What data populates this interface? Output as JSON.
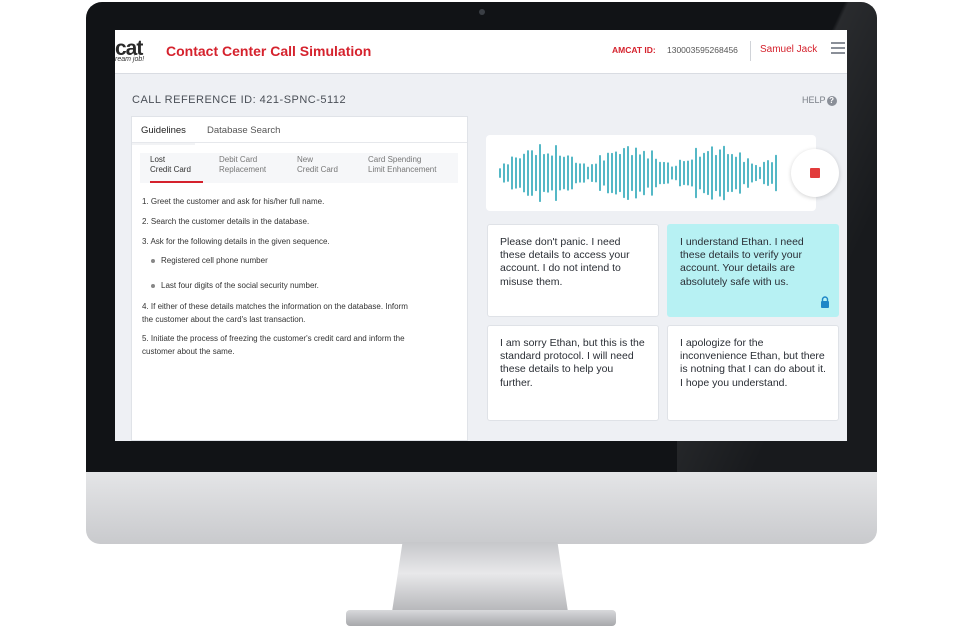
{
  "header": {
    "logo_text": "cat",
    "logo_tagline": "ream job!",
    "title": "Contact Center Call Simulation",
    "amcat_label": "AMCAT ID:",
    "amcat_id": "130003595268456",
    "user_name": "Samuel Jack"
  },
  "call_reference": "CALL REFERENCE ID: 421-SPNC-5112",
  "help_label": "HELP",
  "left_panel": {
    "tabs": [
      "Guidelines",
      "Database Search"
    ],
    "active_tab": "Guidelines",
    "sub_tabs": [
      {
        "line1": "Lost",
        "line2": "Credit Card"
      },
      {
        "line1": "Debit Card",
        "line2": "Replacement"
      },
      {
        "line1": "New",
        "line2": "Credit Card"
      },
      {
        "line1": "Card Spending",
        "line2": "Limit Enhancement"
      }
    ],
    "steps": [
      "1. Greet the customer and ask for his/her full name.",
      "2. Search the customer details in the database.",
      "3. Ask for the following details in the given sequence.",
      "4. If either of these details matches the information on the database. Inform",
      "the customer about the card's last transaction.",
      "5. Initiate the process of freezing the customer's credit card and inform the",
      "customer about the same."
    ],
    "bullets": [
      "Registered cell phone number",
      "Last four digits of the social security number."
    ]
  },
  "responses": [
    {
      "text": "Please don't panic. I need these details to access your account. I do not intend to misuse them.",
      "selected": false
    },
    {
      "text": "I understand Ethan. I need these details to verify your account. Your details are absolutely safe with us.",
      "selected": true
    },
    {
      "text": "I am sorry Ethan, but this is the standard protocol. I will need these details to help you further.",
      "selected": false
    },
    {
      "text": "I apologize for the inconvenience Ethan, but there is notning that I can do about it. I hope you understand.",
      "selected": false
    }
  ],
  "colors": {
    "accent_red": "#d5222d",
    "wave_teal": "#2aa7b8",
    "selected_bg": "#b7f1f3"
  },
  "icons": [
    "menu-icon",
    "help-icon",
    "stop-record-icon",
    "lock-icon"
  ]
}
